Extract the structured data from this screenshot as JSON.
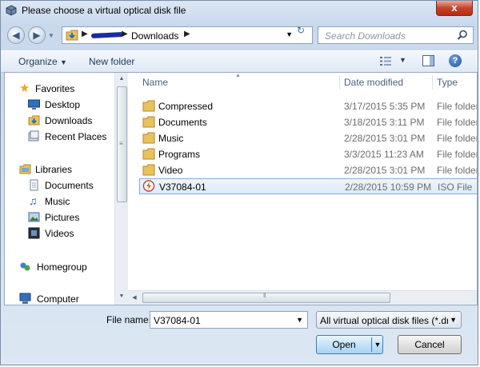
{
  "window": {
    "title": "Please choose a virtual optical disk file",
    "close_label": "x"
  },
  "address": {
    "crumb": "Downloads",
    "search_placeholder": "Search Downloads"
  },
  "toolbar": {
    "organize": "Organize",
    "new_folder": "New folder"
  },
  "nav": {
    "items": [
      {
        "label": "Favorites",
        "icon": "star-icon"
      },
      {
        "label": "Desktop",
        "icon": "desktop-icon"
      },
      {
        "label": "Downloads",
        "icon": "downloads-icon"
      },
      {
        "label": "Recent Places",
        "icon": "recent-places-icon"
      },
      {
        "label": "Libraries",
        "icon": "libraries-icon"
      },
      {
        "label": "Documents",
        "icon": "documents-icon"
      },
      {
        "label": "Music",
        "icon": "music-icon"
      },
      {
        "label": "Pictures",
        "icon": "pictures-icon"
      },
      {
        "label": "Videos",
        "icon": "videos-icon"
      },
      {
        "label": "Homegroup",
        "icon": "homegroup-icon"
      },
      {
        "label": "Computer",
        "icon": "computer-icon"
      }
    ]
  },
  "columns": {
    "name": "Name",
    "date": "Date modified",
    "type": "Type"
  },
  "files": [
    {
      "name": "Compressed",
      "date": "3/17/2015 5:35 PM",
      "type": "File folder",
      "icon": "folder-icon"
    },
    {
      "name": "Documents",
      "date": "3/18/2015 3:11 PM",
      "type": "File folder",
      "icon": "folder-icon"
    },
    {
      "name": "Music",
      "date": "2/28/2015 3:01 PM",
      "type": "File folder",
      "icon": "folder-icon"
    },
    {
      "name": "Programs",
      "date": "3/3/2015 11:23 AM",
      "type": "File folder",
      "icon": "folder-icon"
    },
    {
      "name": "Video",
      "date": "2/28/2015 3:01 PM",
      "type": "File folder",
      "icon": "folder-icon"
    },
    {
      "name": "V37084-01",
      "date": "2/28/2015 10:59 PM",
      "type": "ISO File",
      "icon": "iso-file-icon",
      "selected": true
    }
  ],
  "bottom": {
    "filename_label": "File name:",
    "filename_value": "V37084-01",
    "filter_value": "All virtual optical disk files (*.dr",
    "open_label": "Open",
    "cancel_label": "Cancel"
  }
}
